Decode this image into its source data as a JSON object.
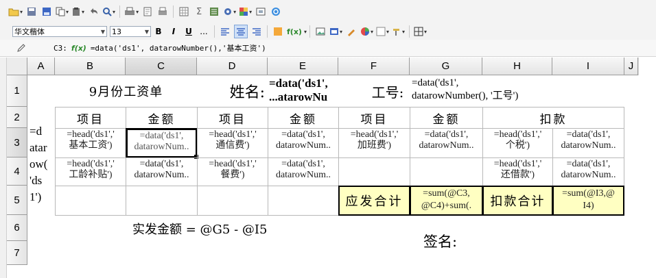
{
  "toolbar1": {
    "icons": [
      "open-folder-icon",
      "save-icon",
      "save-as-icon",
      "copy-icon",
      "paste-icon",
      "undo-icon",
      "find-icon",
      "print-icon",
      "print-preview-icon",
      "page-setup-icon",
      "grid-icon",
      "sum-icon",
      "report-icon",
      "settings-icon",
      "color-icon",
      "fullscreen-icon",
      "help-icon"
    ],
    "sum_glyph": "Σ"
  },
  "toolbar2": {
    "font_name": "华文楷体",
    "font_size": "13",
    "bold": "B",
    "italic": "I",
    "underline": "U",
    "more": "...",
    "fx": "f(x)"
  },
  "formula_bar": {
    "cell_ref": "C3:",
    "formula": "=data('ds1', datarowNumber(),'基本工资')"
  },
  "columns": [
    "A",
    "B",
    "C",
    "D",
    "E",
    "F",
    "G",
    "H",
    "I",
    "J"
  ],
  "rows": [
    "1",
    "2",
    "3",
    "4",
    "5",
    "6",
    "7"
  ],
  "cells": {
    "b1": "9月份工资单",
    "d1": "姓名:",
    "e1": "=data('ds1',\n...atarowNu",
    "f1": "工号:",
    "g1": "=data('ds1',\ndatarowNumber(), '工号')",
    "a3": "=d\natar\now(\n'ds\n1')",
    "b2": "项目",
    "c2": "金额",
    "d2": "项目",
    "e2": "金额",
    "f2": "项目",
    "g2": "金额",
    "h2": "扣款",
    "b3": "=head('ds1','\n基本工资')",
    "c3": "=data('ds1',\ndatarowNum..",
    "d3": "=head('ds1','\n通信费')",
    "e3": "=data('ds1',\ndatarowNum..",
    "f3": "=head('ds1','\n加班费')",
    "g3": "=data('ds1',\ndatarowNum..",
    "h3": "=head('ds1','\n个税')",
    "i3": "=data('ds1',\ndatarowNum..",
    "b4": "=head('ds1','\n工龄补贴')",
    "c4": "=data('ds1',\ndatarowNum..",
    "d4": "=head('ds1','\n餐费')",
    "e4": "=data('ds1',\ndatarowNum..",
    "h4": "=head('ds1','\n还借款')",
    "i4": "=data('ds1',\ndatarowNum..",
    "f5": "应发合计",
    "g5": "=sum(@C3,\n@C4)+sum(.",
    "h5": "扣款合计",
    "i5": "=sum(@I3,@\nI4)",
    "c6": "实发金额 = @G5 - @I5",
    "g6": "签名:"
  },
  "colors": {
    "accent_fill": "#ffffc2",
    "selected_border": "#000000"
  }
}
